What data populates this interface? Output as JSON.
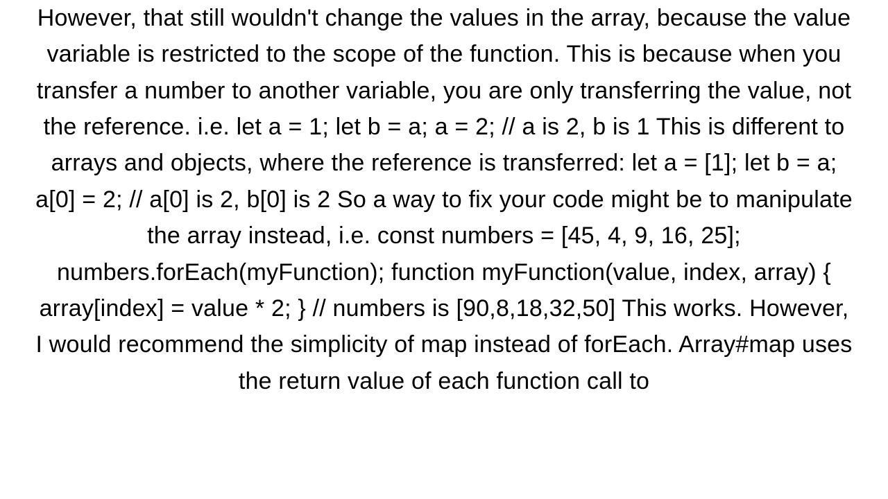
{
  "body": {
    "paragraph": "However, that still wouldn't change the values in the array, because the value variable is restricted to the scope of the function. This is because when you transfer a number to another variable, you are only transferring the value, not the reference. i.e. let a = 1; let b = a; a = 2; // a is 2, b is 1  This is different to arrays and objects, where the reference is transferred: let a = [1]; let b = a; a[0] = 2; // a[0] is 2, b[0] is 2  So a way to fix your code might be to manipulate the array instead, i.e. const numbers = [45, 4, 9, 16, 25]; numbers.forEach(myFunction);  function myFunction(value, index, array) {   array[index] = value * 2; }  // numbers is [90,8,18,32,50]  This works. However, I would recommend the simplicity of map instead of forEach. Array#map uses the return value of each function call to"
  }
}
